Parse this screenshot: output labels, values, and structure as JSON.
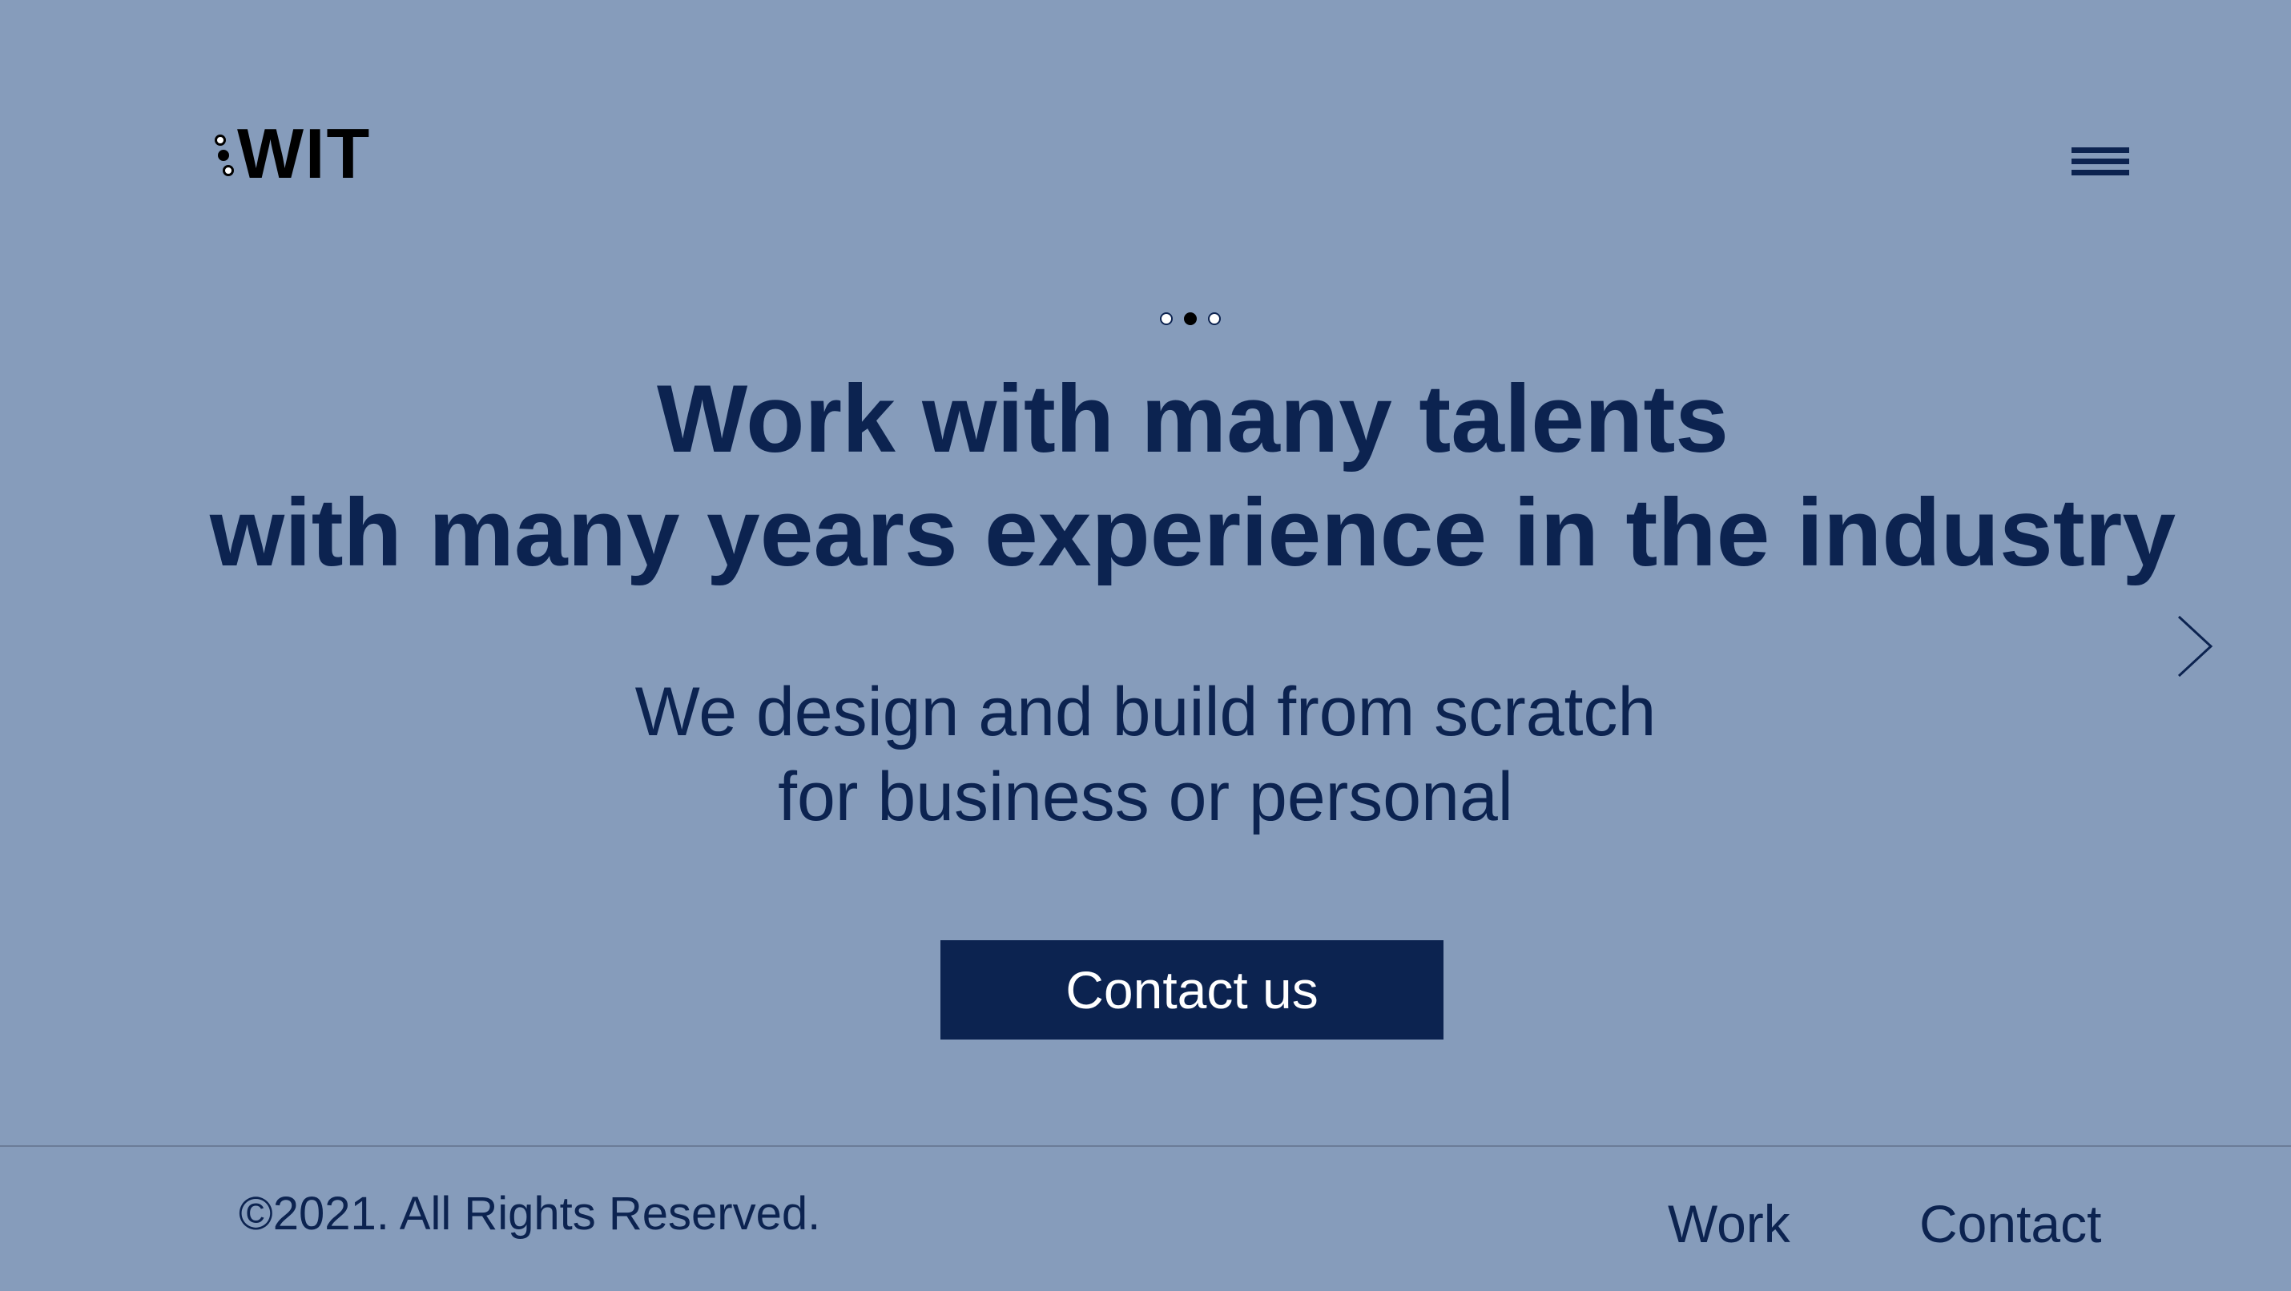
{
  "header": {
    "logo_text": "WIT",
    "menu_icon": "hamburger-menu-icon"
  },
  "hero": {
    "slide_count": 3,
    "active_slide": 2,
    "headline_line1": "Work with many talents",
    "headline_line2": "with many years experience in the industry",
    "subhead_line1": "We design and build from scratch",
    "subhead_line2": "for business or personal",
    "cta_label": "Contact us",
    "next_icon": "chevron-right-icon"
  },
  "footer": {
    "copyright": "©2021. All Rights Reserved.",
    "links": [
      {
        "label": "Work"
      },
      {
        "label": "Contact"
      }
    ]
  },
  "colors": {
    "background": "#869cbb",
    "primary": "#0c2350",
    "button_text": "#ffffff"
  }
}
